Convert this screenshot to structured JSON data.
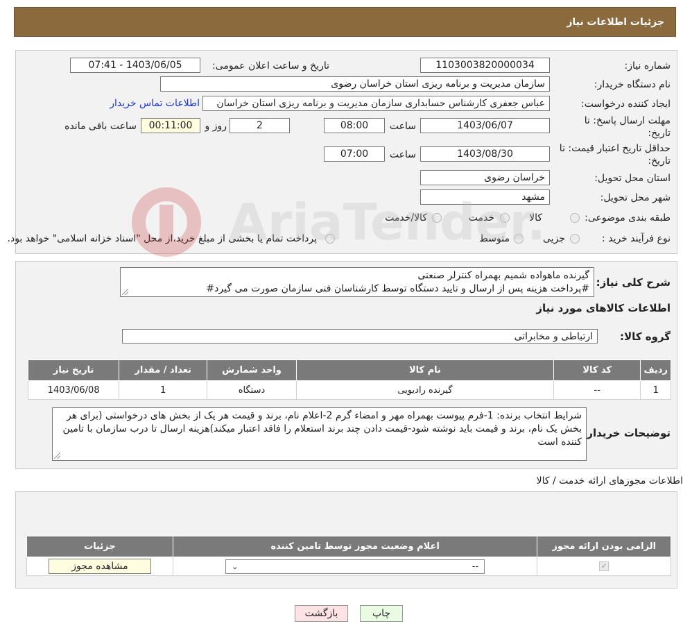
{
  "header": {
    "title": "جزئیات اطلاعات نیاز"
  },
  "form": {
    "need_number_label": "شماره نیاز:",
    "need_number": "1103003820000034",
    "announce_label": "تاریخ و ساعت اعلان عمومی:",
    "announce_value": "1403/06/05 - 07:41",
    "buyer_org_label": "نام دستگاه خریدار:",
    "buyer_org": "سازمان مدیریت و برنامه ریزی استان خراسان رضوی",
    "creator_label": "ایجاد کننده درخواست:",
    "creator": "عباس جعفری کارشناس حسابداری سازمان مدیریت و برنامه ریزی استان خراسان",
    "contact_link": "اطلاعات تماس خریدار",
    "deadline_label_1": "مهلت ارسال پاسخ: تا",
    "deadline_label_2": "تاریخ:",
    "deadline_date": "1403/06/07",
    "time_label": "ساعت",
    "deadline_time": "08:00",
    "days_value": "2",
    "days_label": "روز و",
    "remaining_time": "00:11:00",
    "remaining_label": "ساعت باقی مانده",
    "validity_label_1": "حداقل تاریخ اعتبار قیمت: تا",
    "validity_label_2": "تاریخ:",
    "validity_date": "1403/08/30",
    "validity_time": "07:00",
    "province_label": "استان محل تحویل:",
    "province": "خراسان رضوی",
    "city_label": "شهر محل تحویل:",
    "city": "مشهد",
    "category_label": "طبقه بندی موضوعی:",
    "category_options": [
      "کالا",
      "خدمت",
      "کالا/خدمت"
    ],
    "purchase_type_label": "نوع فرآیند خرید :",
    "purchase_type_options": [
      "جزیی",
      "متوسط"
    ],
    "purchase_note": "پرداخت تمام یا بخشی از مبلغ خرید،از محل \"اسناد خزانه اسلامی\" خواهد بود."
  },
  "summary": {
    "desc_label": "شرح کلی نیاز:",
    "desc_line1": "گیرنده ماهواده شمیم بهمراه کنترلر صنعتی",
    "desc_line2": "#پرداخت هزینه پس از ارسال و تایید دستگاه توسط کارشناسان فنی سازمان صورت می گیرد#",
    "goods_info_title": "اطلاعات کالاهای مورد نیاز",
    "goods_group_label": "گروه کالا:",
    "goods_group": "ارتباطی و مخابراتی",
    "table_headers": [
      "ردیف",
      "کد کالا",
      "نام کالا",
      "واحد شمارش",
      "تعداد / مقدار",
      "تاریخ نیاز"
    ],
    "table_rows": [
      [
        "1",
        "--",
        "گیرنده رادیویی",
        "دستگاه",
        "1",
        "1403/06/08"
      ]
    ],
    "buyer_notes_label": "توضیحات خریدار:",
    "buyer_notes": "شرایط انتخاب برنده: 1-فرم پیوست بهمراه مهر و امضاء گرم 2-اعلام نام، برند و قیمت هر یک از بخش های درخواستی (برای هر بخش یک نام، برند و قیمت باید نوشته شود-قیمت دادن چند برند استعلام را فاقد اعتبار میکند)هزینه ارسال تا درب سازمان با تامین کننده است"
  },
  "permits": {
    "section_title": "اطلاعات مجوزهای ارائه خدمت / کالا",
    "headers": [
      "الزامی بودن ارائه مجوز",
      "اعلام وضعیت مجوز توسط تامین کننده",
      "جزئیات"
    ],
    "select_value": "--",
    "view_button": "مشاهده مجوز"
  },
  "footer": {
    "print_button": "چاپ",
    "back_button": "بازگشت"
  },
  "watermark": {
    "text": "AriaTender.neT"
  },
  "colors": {
    "header_bg": "#8b6a3e",
    "panel_bg": "#f2f2f2",
    "table_header_bg": "#7a7a7a",
    "link": "#1a33d6",
    "back_button_bg": "#fde3e3",
    "print_button_bg": "#eafbe3"
  }
}
